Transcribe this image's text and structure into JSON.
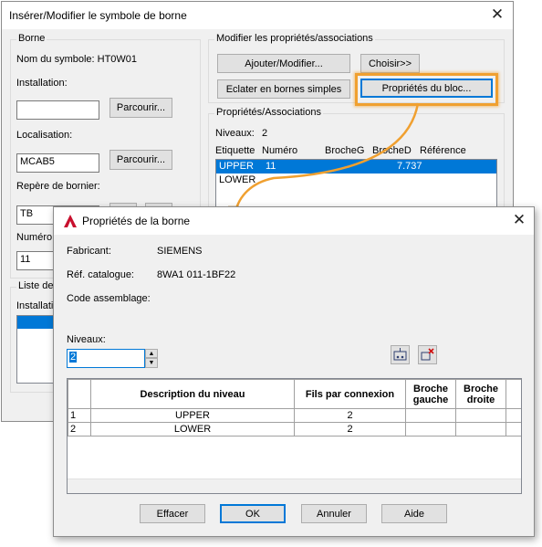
{
  "back_dialog": {
    "title": "Insérer/Modifier le symbole de borne",
    "borne_group": "Borne",
    "nom_symbole_label": "Nom du symbole: HT0W01",
    "installation_label": "Installation:",
    "installation_value": "",
    "parcourir_label": "Parcourir...",
    "localisation_label": "Localisation:",
    "localisation_value": "MCAB5",
    "repere_label": "Repère de bornier:",
    "repere_value": "TB",
    "numero_label": "Numéro:",
    "numero_value": "11",
    "liste_label": "Liste de p",
    "installation_col": "Installatio",
    "modifier_group": "Modifier les propriétés/associations",
    "ajouter_label": "Ajouter/Modifier...",
    "choisir_label": "Choisir>>",
    "eclater_label": "Eclater en bornes simples",
    "proprietes_bloc_label": "Propriétés du bloc...",
    "assoc_group": "Propriétés/Associations",
    "niveaux_label": "Niveaux:",
    "niveaux_value": "2",
    "columns": [
      "Etiquette",
      "Numéro",
      "BrocheG",
      "BrocheD",
      "Référence"
    ],
    "rows": [
      {
        "etiquette": "UPPER",
        "numero": "11",
        "brocheg": "",
        "brocheD": "7.737",
        "reference": ""
      },
      {
        "etiquette": "LOWER",
        "numero": "",
        "brocheg": "",
        "brocheD": "",
        "reference": ""
      }
    ]
  },
  "front_dialog": {
    "title": "Propriétés de la borne",
    "fabricant_label": "Fabricant:",
    "fabricant_value": "SIEMENS",
    "ref_label": "Réf. catalogue:",
    "ref_value": "8WA1 011-1BF22",
    "code_label": "Code assemblage:",
    "niveaux_label": "Niveaux:",
    "niveaux_value": "2",
    "table_headers": [
      "Description du niveau",
      "Fils par connexion",
      "Broche gauche",
      "Broche droite"
    ],
    "table_rows": [
      {
        "num": "1",
        "desc": "UPPER",
        "fils": "2"
      },
      {
        "num": "2",
        "desc": "LOWER",
        "fils": "2"
      }
    ],
    "effacer_label": "Effacer",
    "ok_label": "OK",
    "annuler_label": "Annuler",
    "aide_label": "Aide"
  },
  "colors": {
    "highlight_orange": "#f0a030",
    "selection_blue": "#0078d7",
    "app_red": "#c8102e"
  }
}
